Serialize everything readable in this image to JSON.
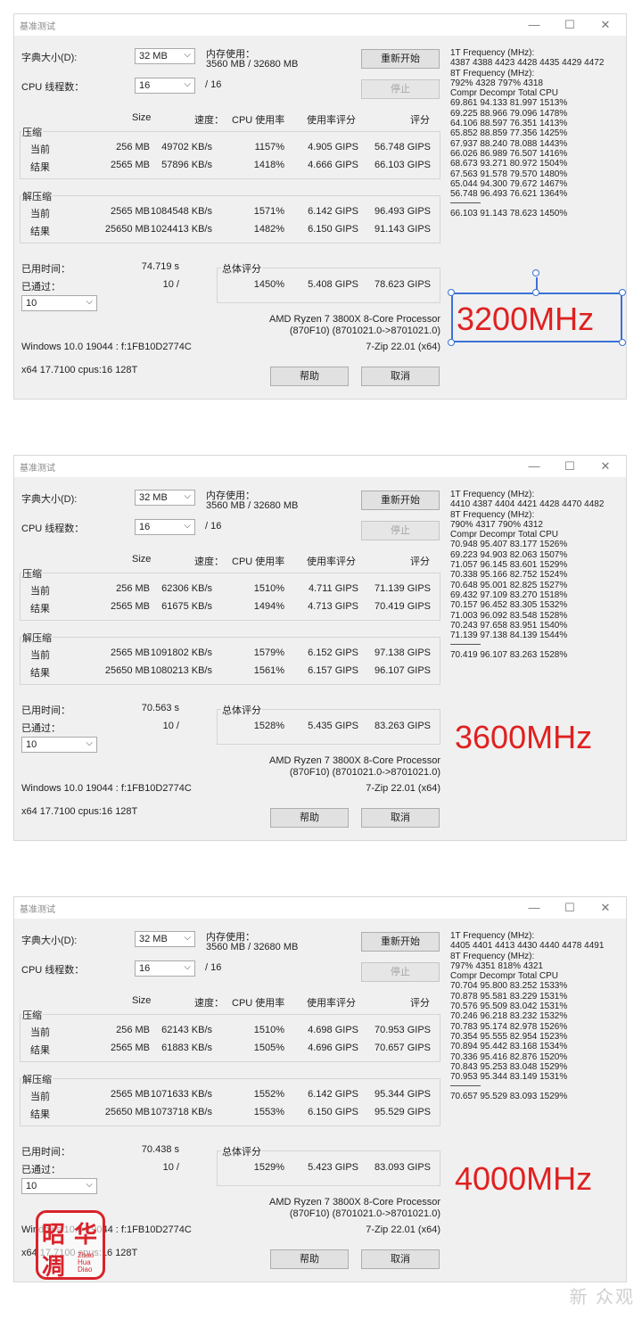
{
  "common": {
    "window_title": "基准测试",
    "minimize": "—",
    "maximize": "☐",
    "close": "✕",
    "dict_size_label": "字典大小(D):",
    "dict_size_value": "32 MB",
    "mem_usage_label": "内存使用：",
    "mem_usage_value": "3560 MB / 32680 MB",
    "restart_button": "重新开始",
    "stop_button": "停止",
    "cpu_threads_label": "CPU 线程数：",
    "cpu_threads_value": "16",
    "cpu_threads_total": "/ 16",
    "col_size": "Size",
    "col_speed": "速度：",
    "col_cpu_usage": "CPU 使用率",
    "col_usage_rating": "使用率评分",
    "col_rating": "评分",
    "compress_label": "压缩",
    "decompress_label": "解压缩",
    "current_label": "当前",
    "result_label": "结果",
    "elapsed_label": "已用时间：",
    "passed_label": "已通过：",
    "passes_select_value": "10",
    "passed_value": "10 /",
    "total_rating_label": "总体评分",
    "cpu_name": "AMD Ryzen 7 3800X 8-Core Processor",
    "cpu_id": "(870F10) (8701021.0->8701021.0)",
    "os_info": "Windows 10.0 19044 : f:1FB10D2774C",
    "zip_version": "7-Zip 22.01 (x64)",
    "arch_info": "x64 17.7100 cpus:16 128T",
    "help_button": "帮助",
    "cancel_button": "取消"
  },
  "panels": [
    {
      "annotation": "3200MHz",
      "annotation_color": "#e02020",
      "elapsed_value": "74.719 s",
      "compress_current": {
        "size": "256 MB",
        "speed": "49702 KB/s",
        "cpu": "1157%",
        "usage_rating": "4.905 GIPS",
        "rating": "56.748 GIPS"
      },
      "compress_result": {
        "size": "2565 MB",
        "speed": "57896 KB/s",
        "cpu": "1418%",
        "usage_rating": "4.666 GIPS",
        "rating": "66.103 GIPS"
      },
      "decompress_current": {
        "size": "2565 MB",
        "speed": "1084548 KB/s",
        "cpu": "1571%",
        "usage_rating": "6.142 GIPS",
        "rating": "96.493 GIPS"
      },
      "decompress_result": {
        "size": "25650 MB",
        "speed": "1024413 KB/s",
        "cpu": "1482%",
        "usage_rating": "6.150 GIPS",
        "rating": "91.143 GIPS"
      },
      "total": {
        "cpu": "1450%",
        "usage_rating": "5.408 GIPS",
        "rating": "78.623 GIPS"
      },
      "freq_lines": [
        "1T Frequency (MHz):",
        " 4387 4388 4423 4428 4435 4429 4472",
        "8T Frequency (MHz):",
        " 792% 4328 797% 4318",
        "Compr Decompr Total  CPU",
        "69.861  94.133  81.997  1513%",
        "69.225  88.966  79.096  1478%",
        "64.106  88.597  76.351  1413%",
        "65.852  88.859  77.356  1425%",
        "67.937  88.240  78.088  1443%",
        "66.026  86.989  76.507  1416%",
        "68.673  93.271  80.972  1504%",
        "67.563  91.578  79.570  1480%",
        "65.044  94.300  79.672  1467%",
        "56.748  96.493  76.621  1364%"
      ],
      "freq_total": "66.103  91.143  78.623  1450%"
    },
    {
      "annotation": "3600MHz",
      "annotation_color": "#e02020",
      "elapsed_value": "70.563 s",
      "compress_current": {
        "size": "256 MB",
        "speed": "62306 KB/s",
        "cpu": "1510%",
        "usage_rating": "4.711 GIPS",
        "rating": "71.139 GIPS"
      },
      "compress_result": {
        "size": "2565 MB",
        "speed": "61675 KB/s",
        "cpu": "1494%",
        "usage_rating": "4.713 GIPS",
        "rating": "70.419 GIPS"
      },
      "decompress_current": {
        "size": "2565 MB",
        "speed": "1091802 KB/s",
        "cpu": "1579%",
        "usage_rating": "6.152 GIPS",
        "rating": "97.138 GIPS"
      },
      "decompress_result": {
        "size": "25650 MB",
        "speed": "1080213 KB/s",
        "cpu": "1561%",
        "usage_rating": "6.157 GIPS",
        "rating": "96.107 GIPS"
      },
      "total": {
        "cpu": "1528%",
        "usage_rating": "5.435 GIPS",
        "rating": "83.263 GIPS"
      },
      "freq_lines": [
        "1T Frequency (MHz):",
        " 4410 4387 4404 4421 4428 4470 4482",
        "8T Frequency (MHz):",
        " 790% 4317 790% 4312",
        "Compr Decompr Total  CPU",
        "70.948  95.407  83.177  1526%",
        "69.223  94.903  82.063  1507%",
        "71.057  96.145  83.601  1529%",
        "70.338  95.166  82.752  1524%",
        "70.648  95.001  82.825  1527%",
        "69.432  97.109  83.270  1518%",
        "70.157  96.452  83.305  1532%",
        "71.003  96.092  83.548  1528%",
        "70.243  97.658  83.951  1540%",
        "71.139  97.138  84.139  1544%"
      ],
      "freq_total": "70.419  96.107  83.263  1528%"
    },
    {
      "annotation": "4000MHz",
      "annotation_color": "#e02020",
      "elapsed_value": "70.438 s",
      "compress_current": {
        "size": "256 MB",
        "speed": "62143 KB/s",
        "cpu": "1510%",
        "usage_rating": "4.698 GIPS",
        "rating": "70.953 GIPS"
      },
      "compress_result": {
        "size": "2565 MB",
        "speed": "61883 KB/s",
        "cpu": "1505%",
        "usage_rating": "4.696 GIPS",
        "rating": "70.657 GIPS"
      },
      "decompress_current": {
        "size": "2565 MB",
        "speed": "1071633 KB/s",
        "cpu": "1552%",
        "usage_rating": "6.142 GIPS",
        "rating": "95.344 GIPS"
      },
      "decompress_result": {
        "size": "25650 MB",
        "speed": "1073718 KB/s",
        "cpu": "1553%",
        "usage_rating": "6.150 GIPS",
        "rating": "95.529 GIPS"
      },
      "total": {
        "cpu": "1529%",
        "usage_rating": "5.423 GIPS",
        "rating": "83.093 GIPS"
      },
      "freq_lines": [
        "1T Frequency (MHz):",
        " 4405 4401 4413 4430 4440 4478 4491",
        "8T Frequency (MHz):",
        " 797% 4351 818% 4321",
        "Compr Decompr Total  CPU",
        "70.704  95.800  83.252  1533%",
        "70.878  95.581  83.229  1531%",
        "70.576  95.509  83.042  1531%",
        "70.246  96.218  83.232  1532%",
        "70.783  95.174  82.978  1526%",
        "70.354  95.555  82.954  1523%",
        "70.894  95.442  83.168  1534%",
        "70.336  95.416  82.876  1520%",
        "70.843  95.253  83.048  1529%",
        "70.953  95.344  83.149  1531%"
      ],
      "freq_total": "70.657  95.529  83.093  1529%"
    }
  ],
  "seal": {
    "char1": "昭",
    "char2": "华",
    "char3": "凋",
    "latin": "Zhao Hua Diao",
    "brand_color": "#d9232a"
  },
  "watermark": "新 众观"
}
